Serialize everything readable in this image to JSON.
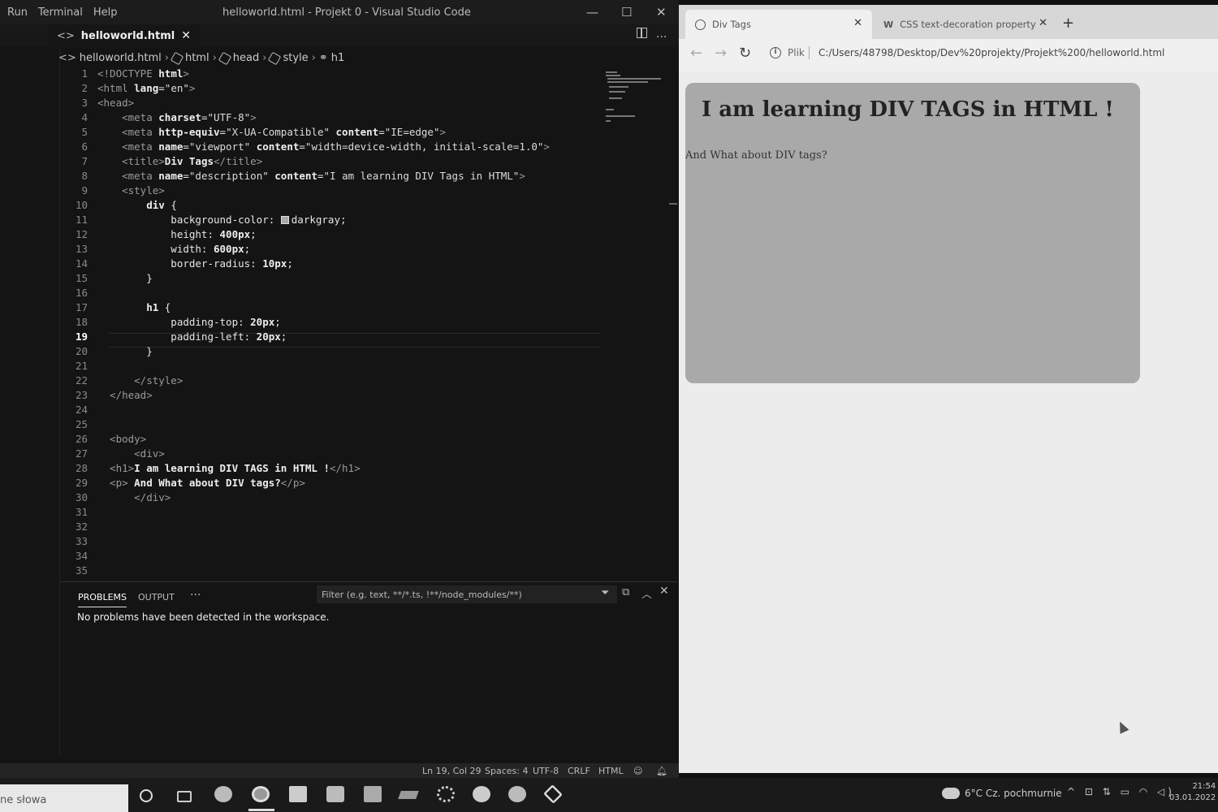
{
  "vscode": {
    "menu": [
      "Run",
      "Terminal",
      "Help"
    ],
    "title": "helloworld.html - Projekt 0 - Visual Studio Code",
    "window_controls": {
      "minimize": "—",
      "maximize": "☐",
      "close": "✕"
    },
    "more": "···",
    "tab": {
      "label": "helloworld.html",
      "close": "✕"
    },
    "editor_more": "···",
    "breadcrumb": [
      "helloworld.html",
      "html",
      "head",
      "style",
      "h1"
    ],
    "active_line": 19
  },
  "code": [
    {
      "n": "1",
      "t": [
        [
          "tag",
          "<!DOCTYPE "
        ],
        [
          "kw",
          "html"
        ],
        [
          "tag",
          ">"
        ]
      ]
    },
    {
      "n": "2",
      "t": [
        [
          "tag",
          "<html "
        ],
        [
          "kw",
          "lang"
        ],
        [
          "plain",
          "="
        ],
        [
          "str",
          "\"en\""
        ],
        [
          "tag",
          ">"
        ]
      ]
    },
    {
      "n": "3",
      "t": [
        [
          "tag",
          "<head>"
        ]
      ]
    },
    {
      "n": "4",
      "t": [
        [
          "tag",
          "    <meta "
        ],
        [
          "kw",
          "charset"
        ],
        [
          "plain",
          "="
        ],
        [
          "str",
          "\"UTF-8\""
        ],
        [
          "tag",
          ">"
        ]
      ]
    },
    {
      "n": "5",
      "t": [
        [
          "tag",
          "    <meta "
        ],
        [
          "kw",
          "http-equiv"
        ],
        [
          "plain",
          "="
        ],
        [
          "str",
          "\"X-UA-Compatible\""
        ],
        [
          "plain",
          " "
        ],
        [
          "kw",
          "content"
        ],
        [
          "plain",
          "="
        ],
        [
          "str",
          "\"IE=edge\""
        ],
        [
          "tag",
          ">"
        ]
      ]
    },
    {
      "n": "6",
      "t": [
        [
          "tag",
          "    <meta "
        ],
        [
          "kw",
          "name"
        ],
        [
          "plain",
          "="
        ],
        [
          "str",
          "\"viewport\""
        ],
        [
          "plain",
          " "
        ],
        [
          "kw",
          "content"
        ],
        [
          "plain",
          "="
        ],
        [
          "str",
          "\"width=device-width, initial-scale=1.0\""
        ],
        [
          "tag",
          ">"
        ]
      ]
    },
    {
      "n": "7",
      "t": [
        [
          "tag",
          "    <title>"
        ],
        [
          "kw",
          "Div Tags"
        ],
        [
          "tag",
          "</title>"
        ]
      ]
    },
    {
      "n": "8",
      "t": [
        [
          "tag",
          "    <meta "
        ],
        [
          "kw",
          "name"
        ],
        [
          "plain",
          "="
        ],
        [
          "str",
          "\"description\""
        ],
        [
          "plain",
          " "
        ],
        [
          "kw",
          "content"
        ],
        [
          "plain",
          "="
        ],
        [
          "str",
          "\"I am learning DIV Tags in HTML\""
        ],
        [
          "tag",
          ">"
        ]
      ]
    },
    {
      "n": "9",
      "t": [
        [
          "tag",
          "    <style>"
        ]
      ]
    },
    {
      "n": "10",
      "t": [
        [
          "kw",
          "        div "
        ],
        [
          "plain",
          "{"
        ]
      ]
    },
    {
      "n": "11",
      "t": [
        [
          "plain",
          "            background-color: "
        ],
        [
          "swatch",
          ""
        ],
        [
          "plain",
          "darkgray;"
        ]
      ]
    },
    {
      "n": "12",
      "t": [
        [
          "plain",
          "            height: "
        ],
        [
          "kw",
          "400px"
        ],
        [
          "plain",
          ";"
        ]
      ]
    },
    {
      "n": "13",
      "t": [
        [
          "plain",
          "            width: "
        ],
        [
          "kw",
          "600px"
        ],
        [
          "plain",
          ";"
        ]
      ]
    },
    {
      "n": "14",
      "t": [
        [
          "plain",
          "            border-radius: "
        ],
        [
          "kw",
          "10px"
        ],
        [
          "plain",
          ";"
        ]
      ]
    },
    {
      "n": "15",
      "t": [
        [
          "plain",
          "        }"
        ]
      ]
    },
    {
      "n": "16",
      "t": []
    },
    {
      "n": "17",
      "t": [
        [
          "kw",
          "        h1 "
        ],
        [
          "plain",
          "{"
        ]
      ]
    },
    {
      "n": "18",
      "t": [
        [
          "plain",
          "            padding-top: "
        ],
        [
          "kw",
          "20px"
        ],
        [
          "plain",
          ";"
        ]
      ]
    },
    {
      "n": "19",
      "t": [
        [
          "plain",
          "            padding-left: "
        ],
        [
          "kw",
          "20px"
        ],
        [
          "plain",
          ";"
        ]
      ]
    },
    {
      "n": "20",
      "t": [
        [
          "plain",
          "        }"
        ]
      ]
    },
    {
      "n": "21",
      "t": []
    },
    {
      "n": "22",
      "t": [
        [
          "tag",
          "      </style>"
        ]
      ]
    },
    {
      "n": "23",
      "t": [
        [
          "tag",
          "  </head>"
        ]
      ]
    },
    {
      "n": "24",
      "t": []
    },
    {
      "n": "25",
      "t": []
    },
    {
      "n": "26",
      "t": [
        [
          "tag",
          "  <body>"
        ]
      ]
    },
    {
      "n": "27",
      "t": [
        [
          "tag",
          "      <div>"
        ]
      ]
    },
    {
      "n": "28",
      "t": [
        [
          "tag",
          "  <h1>"
        ],
        [
          "kw",
          "I am learning DIV TAGS in HTML !"
        ],
        [
          "tag",
          "</h1>"
        ]
      ]
    },
    {
      "n": "29",
      "t": [
        [
          "tag",
          "  <p> "
        ],
        [
          "kw",
          "And What about DIV tags?"
        ],
        [
          "tag",
          "</p>"
        ]
      ]
    },
    {
      "n": "30",
      "t": [
        [
          "tag",
          "      </div>"
        ]
      ]
    },
    {
      "n": "31",
      "t": []
    },
    {
      "n": "32",
      "t": []
    },
    {
      "n": "33",
      "t": []
    },
    {
      "n": "34",
      "t": []
    },
    {
      "n": "35",
      "t": []
    }
  ],
  "panel": {
    "tabs": [
      "PROBLEMS",
      "OUTPUT"
    ],
    "more": "···",
    "filter_placeholder": "Filter (e.g. text, **/*.ts, !**/node_modules/**)",
    "message": "No problems have been detected in the workspace.",
    "close": "✕"
  },
  "status": {
    "position": "Ln 19, Col 29",
    "spaces": "Spaces: 4",
    "encoding": "UTF-8",
    "eol": "CRLF",
    "language": "HTML"
  },
  "browser": {
    "tabs": [
      {
        "label": "Div Tags",
        "close": "✕"
      },
      {
        "label": "CSS text-decoration property",
        "close": "✕",
        "favicon": "W"
      }
    ],
    "new_tab": "+",
    "back": "←",
    "forward": "→",
    "reload": "↻",
    "info": "i",
    "protocol_label": "Plik",
    "url": "C:/Users/48798/Desktop/Dev%20projekty/Projekt%200/helloworld.html",
    "page": {
      "heading": "I am learning DIV TAGS in HTML !",
      "paragraph": "And What about DIV tags?"
    }
  },
  "taskbar": {
    "search_text": "ne słowa",
    "weather": "6°C  Cz. pochmurnie",
    "tray": "^ ⊡ ⇅ ▭ ◠ ◁)",
    "time": "21:54",
    "date": "03.01.2022"
  }
}
